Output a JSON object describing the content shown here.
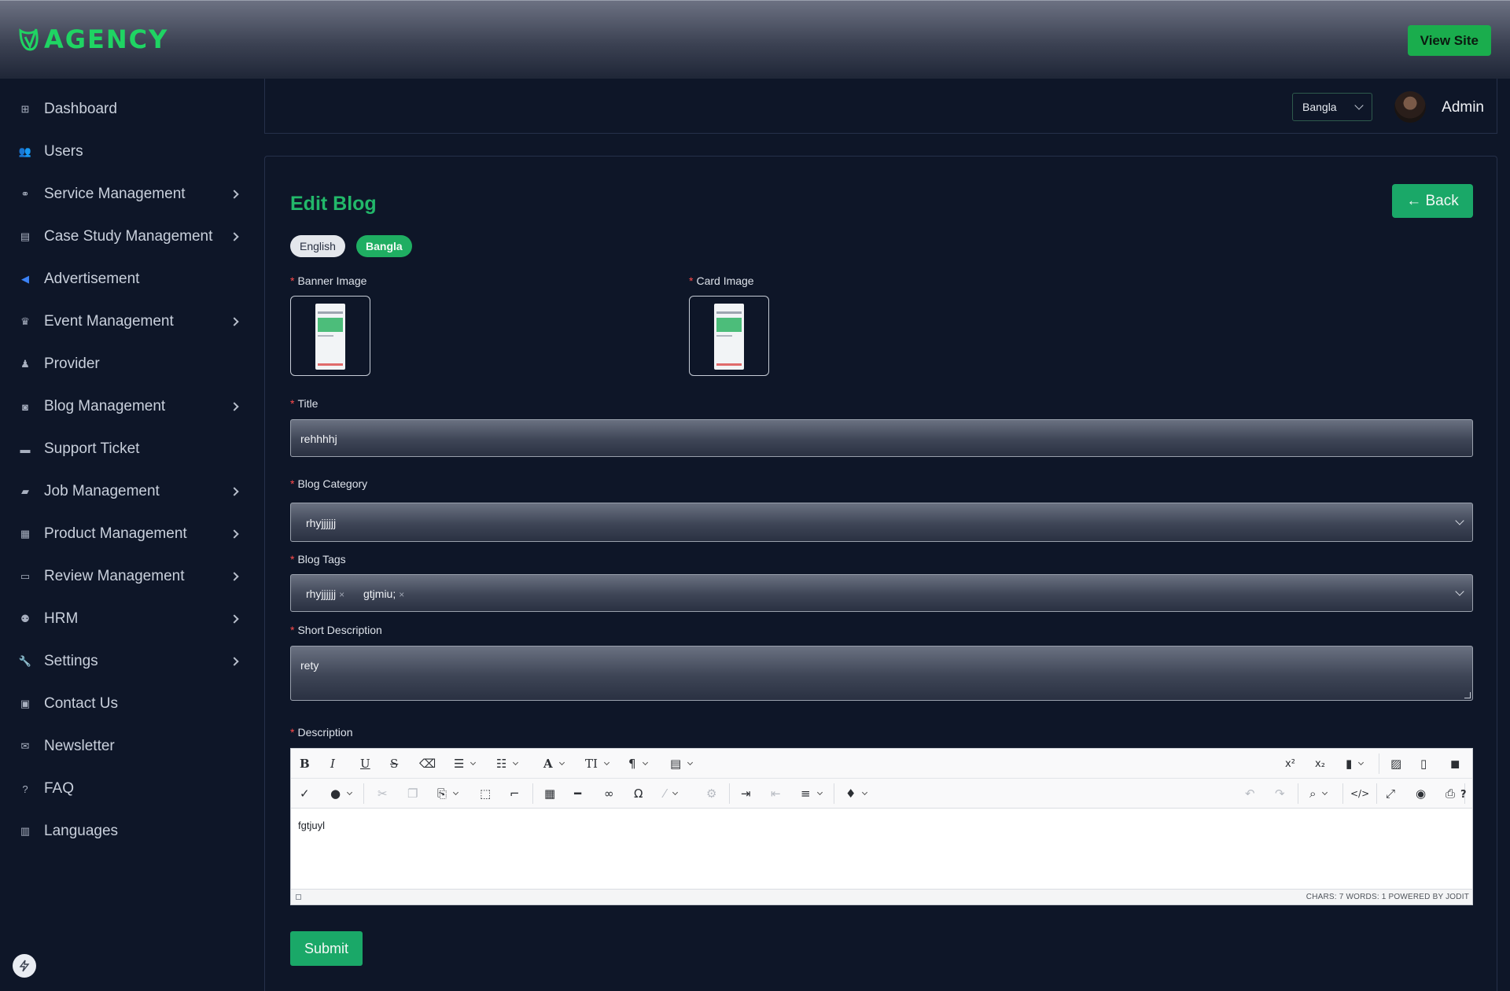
{
  "header": {
    "brand": "AGENCY",
    "view_site": "View Site"
  },
  "sidebar": {
    "items": [
      {
        "label": "Dashboard",
        "icon": "dashboard-icon",
        "glyph": "⊞",
        "chevron": false
      },
      {
        "label": "Users",
        "icon": "users-icon",
        "glyph": "👥",
        "chevron": false
      },
      {
        "label": "Service Management",
        "icon": "service-icon",
        "glyph": "⚭",
        "chevron": true
      },
      {
        "label": "Case Study Management",
        "icon": "document-icon",
        "glyph": "▤",
        "chevron": true
      },
      {
        "label": "Advertisement",
        "icon": "megaphone-icon",
        "glyph": "◀",
        "chevron": false
      },
      {
        "label": "Event Management",
        "icon": "trophy-icon",
        "glyph": "♛",
        "chevron": true
      },
      {
        "label": "Provider",
        "icon": "provider-icon",
        "glyph": "♟",
        "chevron": false
      },
      {
        "label": "Blog Management",
        "icon": "blog-icon",
        "glyph": "◙",
        "chevron": true
      },
      {
        "label": "Support Ticket",
        "icon": "ticket-icon",
        "glyph": "▬",
        "chevron": false
      },
      {
        "label": "Job Management",
        "icon": "briefcase-icon",
        "glyph": "▰",
        "chevron": true
      },
      {
        "label": "Product Management",
        "icon": "product-icon",
        "glyph": "▦",
        "chevron": true
      },
      {
        "label": "Review Management",
        "icon": "review-icon",
        "glyph": "▭",
        "chevron": true
      },
      {
        "label": "HRM",
        "icon": "hrm-icon",
        "glyph": "⚉",
        "chevron": true
      },
      {
        "label": "Settings",
        "icon": "wrench-icon",
        "glyph": "🔧",
        "chevron": true
      },
      {
        "label": "Contact Us",
        "icon": "contact-card-icon",
        "glyph": "▣",
        "chevron": false
      },
      {
        "label": "Newsletter",
        "icon": "envelope-icon",
        "glyph": "✉",
        "chevron": false
      },
      {
        "label": "FAQ",
        "icon": "question-icon",
        "glyph": "?",
        "chevron": false
      },
      {
        "label": "Languages",
        "icon": "language-icon",
        "glyph": "▥",
        "chevron": false
      }
    ]
  },
  "topbar": {
    "language_selected": "Bangla",
    "user_name": "Admin"
  },
  "page": {
    "title": "Edit Blog",
    "back_label": "← Back",
    "lang_tabs": [
      "English",
      "Bangla"
    ],
    "active_lang": "Bangla",
    "banner_image_label": "Banner Image",
    "card_image_label": "Card Image",
    "title_label": "Title",
    "title_value": "rehhhhj",
    "category_label": "Blog Category",
    "category_value": "rhyjjjjjj",
    "tags_label": "Blog Tags",
    "tags": [
      "rhyjjjjjj",
      "gtjmiu;"
    ],
    "short_desc_label": "Short Description",
    "short_desc_value": "rety",
    "description_label": "Description",
    "description_value": "fgtjuyl",
    "editor_status": "CHARS: 7   WORDS: 1   POWERED BY JODIT",
    "submit_label": "Submit"
  },
  "colors": {
    "accent": "#1aa868",
    "brand": "#1fd463",
    "background": "#0e1628",
    "required": "#ff4b4b"
  }
}
